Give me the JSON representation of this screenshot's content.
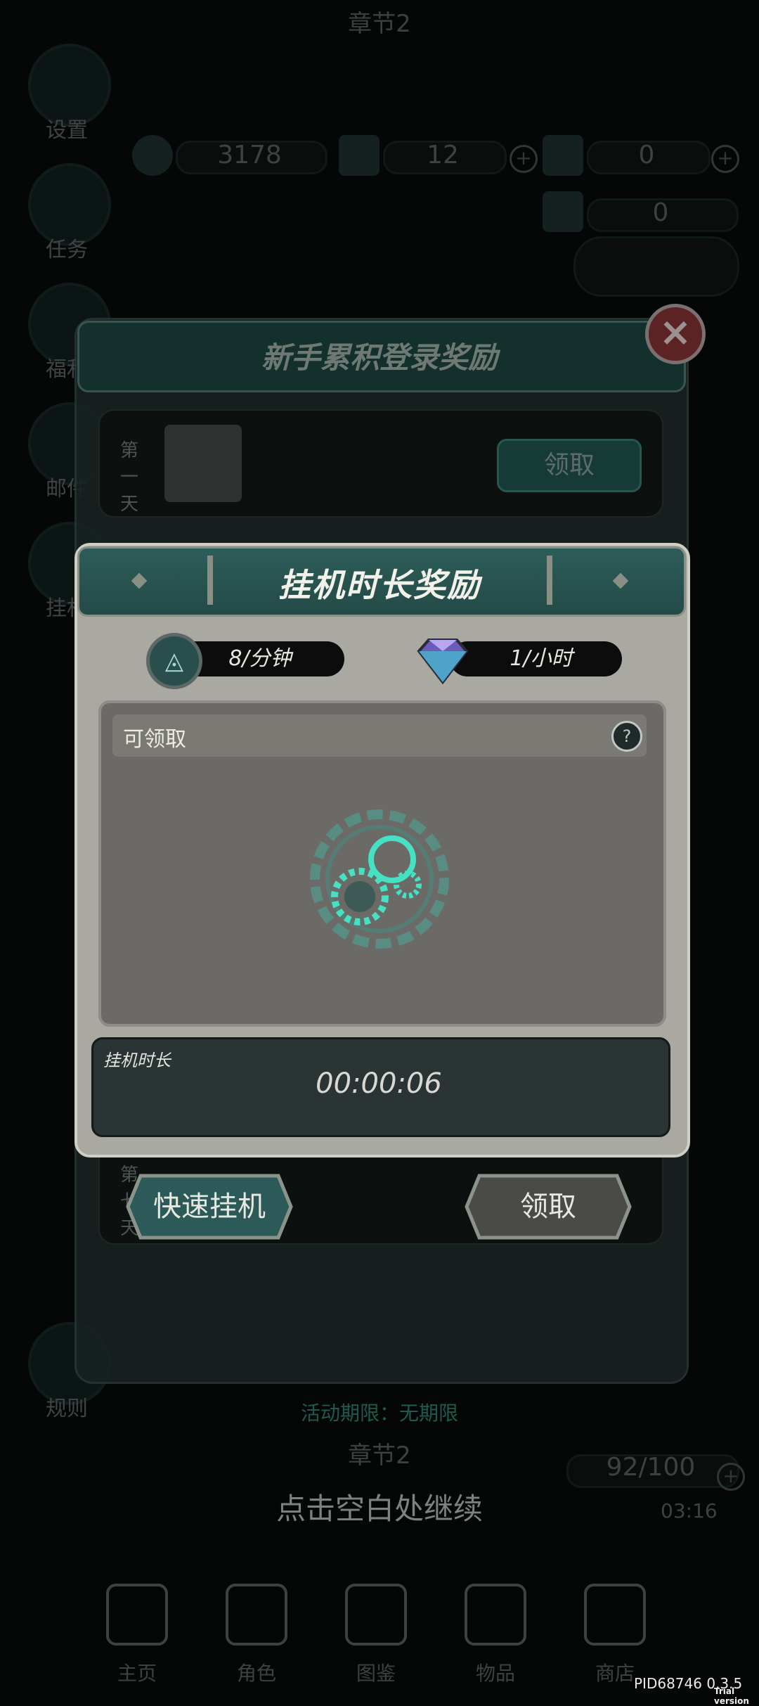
{
  "background": {
    "chapter_top": "章节2",
    "side_menu": [
      {
        "label": "设置",
        "icon": "wrench-icon"
      },
      {
        "label": "任务",
        "icon": "scroll-icon"
      },
      {
        "label": "福利",
        "icon": "gift-icon"
      },
      {
        "label": "邮件",
        "icon": "mail-icon"
      },
      {
        "label": "挂机",
        "icon": "gear-icon"
      }
    ],
    "resources": [
      {
        "value": "3178",
        "icon": "coin-icon"
      },
      {
        "value": "12",
        "icon": "ticket-icon"
      },
      {
        "value": "0",
        "icon": "card-icon"
      },
      {
        "value": "0",
        "icon": "diamond-icon"
      }
    ],
    "rules_label": "规则",
    "stamina": "92/100",
    "stamina_timer": "03:16",
    "chapter_bottom": "章节2",
    "nav": [
      {
        "label": "主页",
        "icon": "home-icon"
      },
      {
        "label": "角色",
        "icon": "characters-icon"
      },
      {
        "label": "图鉴",
        "icon": "book-icon"
      },
      {
        "label": "物品",
        "icon": "bag-icon"
      },
      {
        "label": "商店",
        "icon": "shop-icon"
      }
    ]
  },
  "login_dialog": {
    "title": "新手累积登录奖励",
    "rows": [
      {
        "day_label": "第一天",
        "button": "领取"
      },
      {
        "day_label": "第七天",
        "button": "领取"
      }
    ],
    "period_text": "活动期限：无期限"
  },
  "idle_dialog": {
    "title": "挂机时长奖励",
    "rate_coin": "8/分钟",
    "rate_gem": "1/小时",
    "available_label": "可领取",
    "duration_label": "挂机时长",
    "duration_value": "00:00:06",
    "quick_button": "快速挂机",
    "claim_button": "领取"
  },
  "tap_to_continue": "点击空白处继续",
  "version": "PID68746 0.3.5",
  "trial": "Trial version",
  "colors": {
    "accent": "#2f6a63",
    "panel": "#a9a9a1",
    "background": "#050707"
  }
}
